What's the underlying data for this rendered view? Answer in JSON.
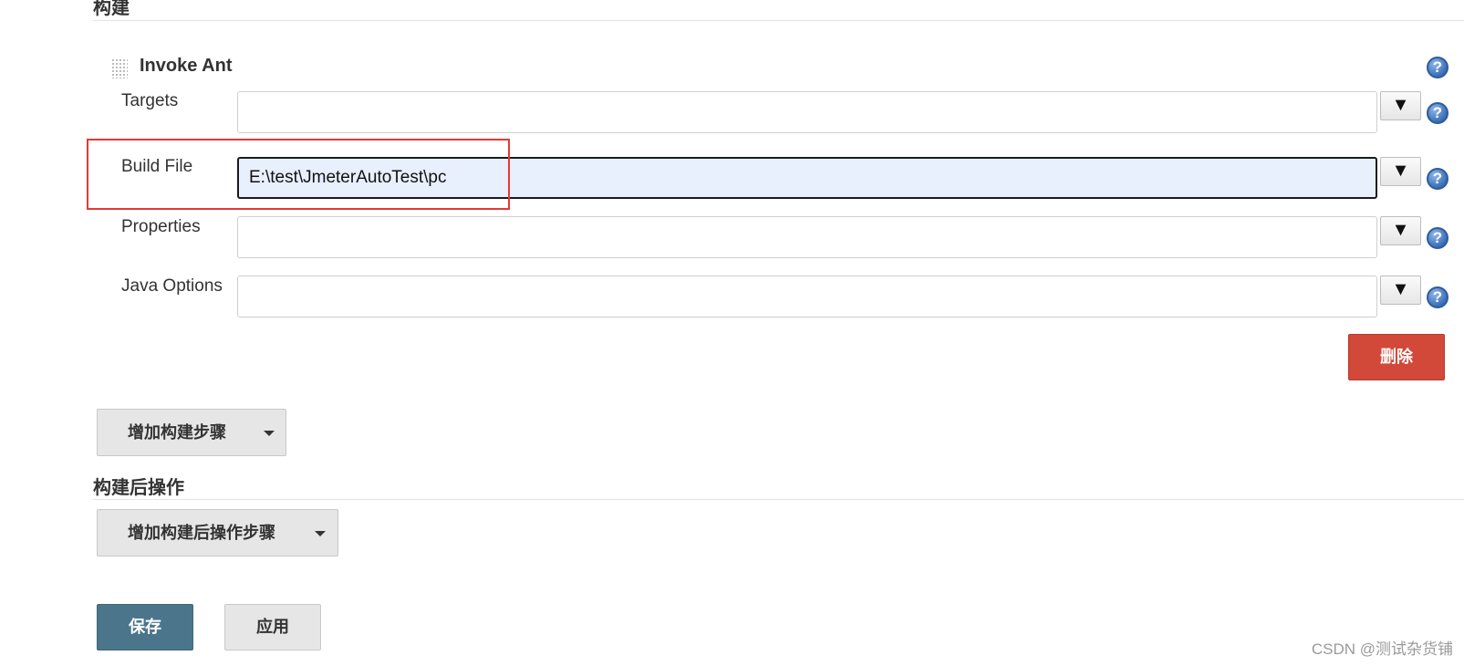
{
  "build_section": {
    "title": "构建",
    "step": {
      "title": "Invoke Ant",
      "fields": [
        {
          "label": "Targets",
          "value": "",
          "expand_symbol": "▼"
        },
        {
          "label": "Build File",
          "value": "E:\\test\\JmeterAutoTest\\pc",
          "expand_symbol": "▼"
        },
        {
          "label": "Properties",
          "value": "",
          "expand_symbol": "▼"
        },
        {
          "label": "Java Options",
          "value": "",
          "expand_symbol": "▼"
        }
      ],
      "help_symbol": "?",
      "delete_label": "删除"
    },
    "add_step_label": "增加构建步骤"
  },
  "post_build_section": {
    "title": "构建后操作",
    "add_step_label": "增加构建后操作步骤"
  },
  "actions": {
    "save_label": "保存",
    "apply_label": "应用"
  },
  "watermark": "CSDN @测试杂货铺",
  "colors": {
    "delete_button": "#d24939",
    "save_button": "#4b758b",
    "highlight_box": "#e53935",
    "focused_input_bg": "#e8f0fd",
    "help_icon": "#3b6fb8"
  },
  "icons": {
    "drag_handle": "drag-handle-icon",
    "help": "help-icon",
    "expand": "triangle-down-icon",
    "dropdown_caret": "caret-down-icon"
  }
}
